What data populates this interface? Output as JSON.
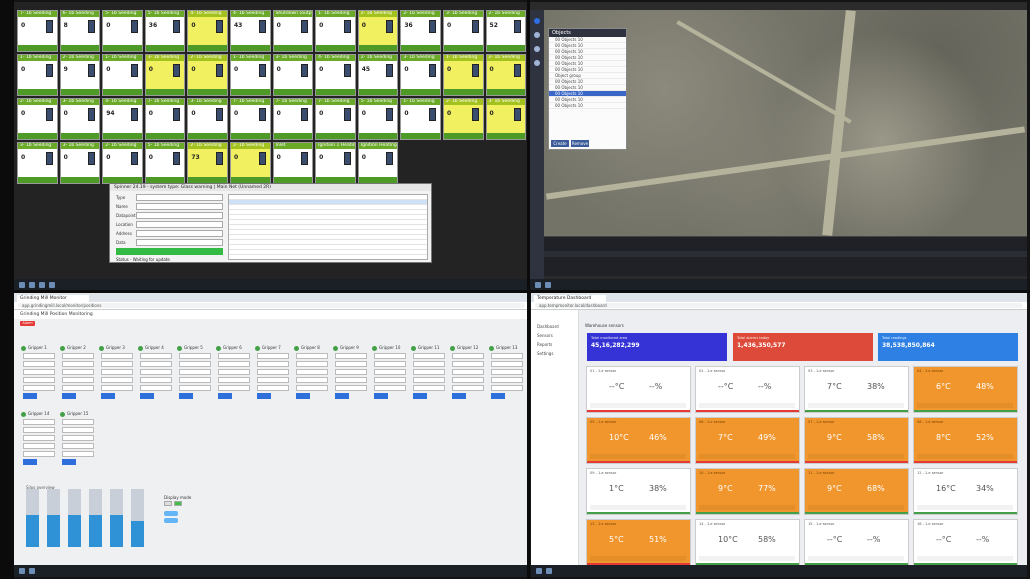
{
  "tl": {
    "tiles": [
      {
        "title": "7- 1b Seeding",
        "value": "0",
        "cls": ""
      },
      {
        "title": "6- 1b Seeding",
        "value": "8",
        "cls": ""
      },
      {
        "title": "5- 1b Seeding",
        "value": "0",
        "cls": ""
      },
      {
        "title": "5- 1b Seeding",
        "value": "36",
        "cls": ""
      },
      {
        "title": "4- 1b Seeding",
        "value": "0",
        "cls": "y"
      },
      {
        "title": "4- 1b Seeding",
        "value": "43",
        "cls": ""
      },
      {
        "title": "Shutdown (output)",
        "value": "0",
        "cls": ""
      },
      {
        "title": "1- 1b Seeding",
        "value": "0",
        "cls": ""
      },
      {
        "title": "2- 1b Seeding",
        "value": "0",
        "cls": "y"
      },
      {
        "title": "2- 1b Seeding",
        "value": "36",
        "cls": ""
      },
      {
        "title": "3- 1b Seeding",
        "value": "0",
        "cls": ""
      },
      {
        "title": "2- 1b Seeding",
        "value": "52",
        "cls": ""
      },
      {
        "title": "1- 1b Seeding",
        "value": "0",
        "cls": ""
      },
      {
        "title": "2- 1b Seeding",
        "value": "9",
        "cls": ""
      },
      {
        "title": "1- 1b Seeding",
        "value": "0",
        "cls": ""
      },
      {
        "title": "3- 1b Seeding",
        "value": "0",
        "cls": "y"
      },
      {
        "title": "2- 1b Seeding",
        "value": "0",
        "cls": "y"
      },
      {
        "title": "1- 1b Seeding",
        "value": "0",
        "cls": ""
      },
      {
        "title": "3- 1b Seeding",
        "value": "0",
        "cls": ""
      },
      {
        "title": "4- 1b Seeding",
        "value": "0",
        "cls": ""
      },
      {
        "title": "2- 1b Seeding",
        "value": "45",
        "cls": ""
      },
      {
        "title": "3- 1b Seeding",
        "value": "0",
        "cls": ""
      },
      {
        "title": "1- 1b Seeding",
        "value": "0",
        "cls": "y"
      },
      {
        "title": "2- 1b Seeding",
        "value": "0",
        "cls": "y"
      },
      {
        "title": "2- 1b Seeding",
        "value": "0",
        "cls": ""
      },
      {
        "title": "3- 1b Seeding",
        "value": "0",
        "cls": ""
      },
      {
        "title": "4- 1b Seeding",
        "value": "94",
        "cls": ""
      },
      {
        "title": "7- 1b Seeding",
        "value": "0",
        "cls": ""
      },
      {
        "title": "3- 1b Seeding",
        "value": "0",
        "cls": ""
      },
      {
        "title": "7- 1b Seeding",
        "value": "0",
        "cls": ""
      },
      {
        "title": "7- 1b Seeding",
        "value": "0",
        "cls": ""
      },
      {
        "title": "7- 1b Seeding",
        "value": "0",
        "cls": ""
      },
      {
        "title": "5- 1b Seeding",
        "value": "0",
        "cls": ""
      },
      {
        "title": "1- 1b Seeding",
        "value": "0",
        "cls": ""
      },
      {
        "title": "2- 1b Seeding",
        "value": "0",
        "cls": "y"
      },
      {
        "title": "3- 1b Seeding",
        "value": "0",
        "cls": "y"
      },
      {
        "title": "3- 1b Seeding",
        "value": "0",
        "cls": ""
      },
      {
        "title": "3- 1b Seeding",
        "value": "0",
        "cls": ""
      },
      {
        "title": "2- 1b Seeding",
        "value": "0",
        "cls": ""
      },
      {
        "title": "5- 1b Seeding",
        "value": "0",
        "cls": ""
      },
      {
        "title": "2- 1b Seeding",
        "value": "73",
        "cls": "y"
      },
      {
        "title": "2- 1b Seeding",
        "value": "0",
        "cls": "y"
      },
      {
        "title": "Inlet",
        "value": "0",
        "cls": ""
      },
      {
        "title": "Ignition 1 Heating",
        "value": "0",
        "cls": ""
      },
      {
        "title": "Ignition Heating",
        "value": "0",
        "cls": ""
      }
    ],
    "dialog": {
      "title": "Spinner 24.19 - system type: Glass warning | Main Net (Unnamed 2R)",
      "fields": [
        "Type",
        "Name",
        "Datapoint",
        "Location",
        "Address",
        "Data"
      ],
      "footer": "Status - Waiting for update"
    }
  },
  "tr": {
    "objects_title": "Objects",
    "objects": [
      "00 Objects 10",
      "00 Objects 10",
      "00 Objects 10",
      "00 Objects 10",
      "00 Objects 10",
      "00 Objects 10",
      "Object group",
      "00 Objects 10",
      "00 Objects 10",
      "00 Objects 10",
      "00 Objects 10",
      "00 Objects 10"
    ],
    "selected_index": 9,
    "btn_create": "Create",
    "btn_remove": "Remove"
  },
  "bl": {
    "tab": "Grinding Mill Monitor",
    "url": "app.grindingmill.local/monitor/positions",
    "title": "Grinding Mill Position Monitoring",
    "badge": "Alarm",
    "positions": [
      "Gripper 1",
      "Gripper 2",
      "Gripper 3",
      "Gripper 4",
      "Gripper 5",
      "Gripper 6",
      "Gripper 7",
      "Gripper 8",
      "Gripper 9",
      "Gripper 10",
      "Gripper 11",
      "Gripper 12",
      "Gripper 13",
      "Gripper 14",
      "Gripper 15"
    ],
    "bars_caption": "Silos overview",
    "bars": [
      0.55,
      0.55,
      0.55,
      0.55,
      0.55,
      0.44
    ],
    "toggle_caption": "Display mode"
  },
  "br": {
    "tab": "Temperature Dashboard",
    "url": "app.tempmonitor.local/dashboard",
    "sidebar": [
      "Dashboard",
      "Sensors",
      "Reports",
      "Settings"
    ],
    "page_title": "Warehouse sensors",
    "stats": [
      {
        "label": "Total monitored area",
        "value": "45,16,282,299",
        "color": "#3532d6"
      },
      {
        "label": "Total alarms today",
        "value": "1,436,350,577",
        "color": "#de4a3a"
      },
      {
        "label": "Total readings",
        "value": "38,538,850,864",
        "color": "#2f80e4"
      }
    ],
    "cards": [
      {
        "name": "01 - 1-e sensor",
        "temp": "--°C",
        "hum": "--%",
        "orange": false,
        "bar": "r"
      },
      {
        "name": "02 - 1-e sensor",
        "temp": "--°C",
        "hum": "--%",
        "orange": false,
        "bar": "r"
      },
      {
        "name": "03 - 1-e sensor",
        "temp": "7°C",
        "hum": "38%",
        "orange": false,
        "bar": "g"
      },
      {
        "name": "04 - 1-e sensor",
        "temp": "6°C",
        "hum": "48%",
        "orange": true,
        "bar": "g"
      },
      {
        "name": "05 - 1-e sensor",
        "temp": "10°C",
        "hum": "46%",
        "orange": true,
        "bar": "r"
      },
      {
        "name": "06 - 1-e sensor",
        "temp": "7°C",
        "hum": "49%",
        "orange": true,
        "bar": "r"
      },
      {
        "name": "07 - 1-e sensor",
        "temp": "9°C",
        "hum": "58%",
        "orange": true,
        "bar": "r"
      },
      {
        "name": "08 - 1-e sensor",
        "temp": "8°C",
        "hum": "52%",
        "orange": true,
        "bar": "r"
      },
      {
        "name": "09 - 1-e sensor",
        "temp": "1°C",
        "hum": "38%",
        "orange": false,
        "bar": "g"
      },
      {
        "name": "10 - 1-e sensor",
        "temp": "9°C",
        "hum": "77%",
        "orange": true,
        "bar": "g"
      },
      {
        "name": "11 - 1-e sensor",
        "temp": "9°C",
        "hum": "68%",
        "orange": true,
        "bar": "g"
      },
      {
        "name": "12 - 1-e sensor",
        "temp": "16°C",
        "hum": "34%",
        "orange": false,
        "bar": "g"
      },
      {
        "name": "13 - 1-e sensor",
        "temp": "5°C",
        "hum": "51%",
        "orange": true,
        "bar": "r"
      },
      {
        "name": "14 - 1-e sensor",
        "temp": "10°C",
        "hum": "58%",
        "orange": false,
        "bar": "g"
      },
      {
        "name": "15 - 1-e sensor",
        "temp": "--°C",
        "hum": "--%",
        "orange": false,
        "bar": "g"
      },
      {
        "name": "16 - 1-e sensor",
        "temp": "--°C",
        "hum": "--%",
        "orange": false,
        "bar": "g"
      }
    ]
  }
}
